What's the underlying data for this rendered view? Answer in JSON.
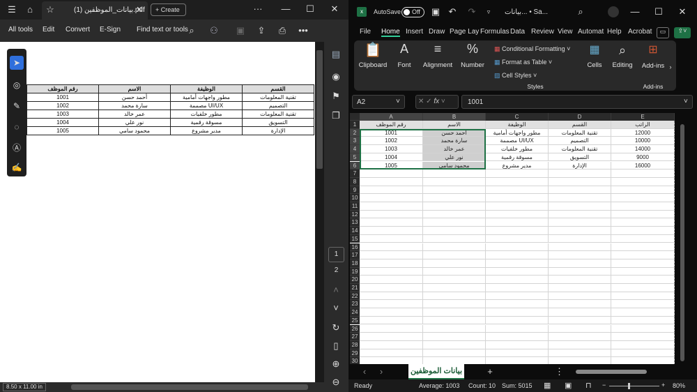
{
  "acrobat": {
    "tab_title": "بيانات_الموظفين (1).pdf",
    "create_label": "Create",
    "toolbar": {
      "all_tools": "All tools",
      "edit": "Edit",
      "convert": "Convert",
      "esign": "E-Sign",
      "find": "Find text or tools"
    },
    "page_size": "8.50 x 11.00 in",
    "pages": [
      "1",
      "2"
    ],
    "table": {
      "headers": [
        "القسم",
        "الوظيفة",
        "الاسم",
        "رقم الموظف"
      ],
      "rows": [
        [
          "تقنية المعلومات",
          "مطور واجهات أمامية",
          "أحمد حسن",
          "1001"
        ],
        [
          "التصميم",
          "مصممة UI/UX",
          "سارة محمد",
          "1002"
        ],
        [
          "تقنية المعلومات",
          "مطور خلفيات",
          "عمر خالد",
          "1003"
        ],
        [
          "التسويق",
          "مسوقة رقمية",
          "نور علي",
          "1004"
        ],
        [
          "الإدارة",
          "مدير مشروع",
          "محمود سامي",
          "1005"
        ]
      ]
    }
  },
  "excel": {
    "autosave": "AutoSave",
    "toggle": "Off",
    "title": "بيانات... • Sa...",
    "tabs": [
      "File",
      "Home",
      "Insert",
      "Draw",
      "Page Lay",
      "Formulas",
      "Data",
      "Review",
      "View",
      "Automat",
      "Help",
      "Acrobat"
    ],
    "ribbon": {
      "clipboard": "Clipboard",
      "font": "Font",
      "alignment": "Alignment",
      "number": "Number",
      "cond": "Conditional Formatting",
      "fat": "Format as Table",
      "cellstyles": "Cell Styles",
      "styles": "Styles",
      "cells": "Cells",
      "editing": "Editing",
      "addins": "Add-ins",
      "addins_group": "Add-ins"
    },
    "namebox": "A2",
    "formula": "1001",
    "columns": [
      "A",
      "B",
      "C",
      "D",
      "E"
    ],
    "sheet": [
      [
        "رقم الموظف",
        "الاسم",
        "الوظيفة",
        "القسم",
        "الراتب"
      ],
      [
        "1001",
        "أحمد حسن",
        "مطور واجهات أمامية",
        "تقنية المعلومات",
        "12000"
      ],
      [
        "1002",
        "سارة محمد",
        "مصممة UI/UX",
        "التصميم",
        "10000"
      ],
      [
        "1003",
        "عمر خالد",
        "مطور خلفيات",
        "تقنية المعلومات",
        "14000"
      ],
      [
        "1004",
        "نور علي",
        "مسوقة رقمية",
        "التسويق",
        "9000"
      ],
      [
        "1005",
        "محمود سامي",
        "مدير مشروع",
        "الإدارة",
        "16000"
      ]
    ],
    "sheet_tab": "بيانات الموظفين",
    "status": {
      "ready": "Ready",
      "average": "Average: 1003",
      "count": "Count: 10",
      "sum": "Sum: 5015",
      "zoom": "80%"
    }
  }
}
